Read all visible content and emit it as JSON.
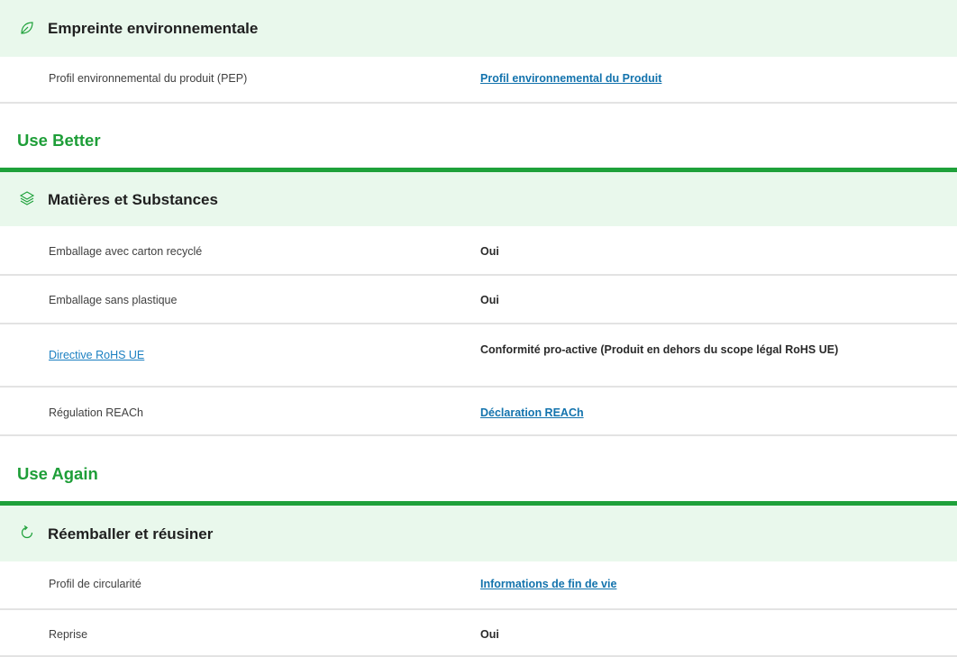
{
  "sections": {
    "empreinte": {
      "title": "Empreinte environnementale",
      "icon": "leaf-icon",
      "rows": [
        {
          "label": "Profil environnemental du produit (PEP)",
          "value": "Profil environnemental du Produit"
        }
      ]
    },
    "matieres": {
      "title": "Matières et Substances",
      "icon": "layers-icon",
      "rows": [
        {
          "label": "Emballage avec carton recyclé",
          "value": "Oui"
        },
        {
          "label": "Emballage sans plastique",
          "value": "Oui"
        },
        {
          "label": "Directive RoHS UE",
          "value": "Conformité pro-active (Produit en dehors du scope légal RoHS UE)"
        },
        {
          "label": "Régulation REACh",
          "value": "Déclaration REACh"
        }
      ]
    },
    "reemballer": {
      "title": "Réemballer et réusiner",
      "icon": "refresh-icon",
      "rows": [
        {
          "label": "Profil de circularité",
          "value": "Informations de fin de vie"
        },
        {
          "label": "Reprise",
          "value": "Oui"
        }
      ]
    }
  },
  "groups": {
    "use_better": "Use Better",
    "use_again": "Use Again"
  },
  "colors": {
    "accent_green": "#1ea13a",
    "header_bg": "#e9f8ec",
    "link_blue": "#137ab8",
    "divider": "#e3e3e3"
  }
}
